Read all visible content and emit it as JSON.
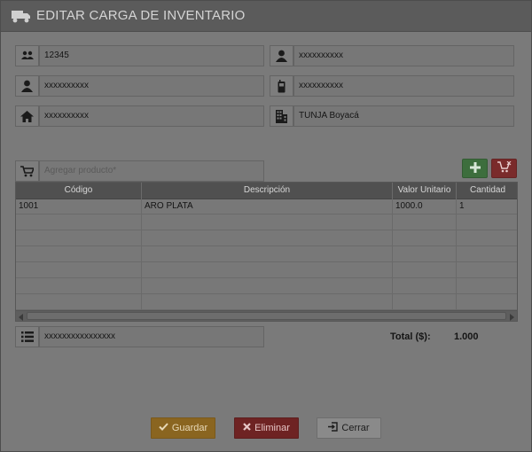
{
  "window": {
    "title": "EDITAR CARGA DE INVENTARIO",
    "title_icon": "truck-icon"
  },
  "form": {
    "id_value": "12345",
    "field_r1c2": "xxxxxxxxxx",
    "field_r2c1": "xxxxxxxxxx",
    "field_r2c2": "xxxxxxxxxx",
    "field_r3c1": "xxxxxxxxxx",
    "city_value": "TUNJA Boyacá",
    "product_placeholder": "Agregar producto*",
    "notes_value": "xxxxxxxxxxxxxxxx"
  },
  "icons": {
    "id": "users-icon",
    "r1c2": "user-icon",
    "r2c1": "user-icon",
    "r2c2": "mobile-phone-icon",
    "r3c1": "home-icon",
    "city": "building-icon",
    "product": "shopping-cart-icon",
    "notes": "list-icon",
    "add": "plus-icon",
    "remove": "cart-remove-icon"
  },
  "table": {
    "columns": [
      "Código",
      "Descripción",
      "Valor Unitario",
      "Cantidad"
    ],
    "rows": [
      [
        "1001",
        "ARO PLATA",
        "1000.0",
        "1"
      ]
    ]
  },
  "total": {
    "label": "Total ($):",
    "value": "1.000"
  },
  "actions": {
    "save_label": "Guardar",
    "delete_label": "Eliminar",
    "close_label": "Cerrar"
  },
  "colors": {
    "save": "#8a6520",
    "delete": "#6e2323",
    "add": "#3d6e3d",
    "remove": "#7a2b2b"
  }
}
